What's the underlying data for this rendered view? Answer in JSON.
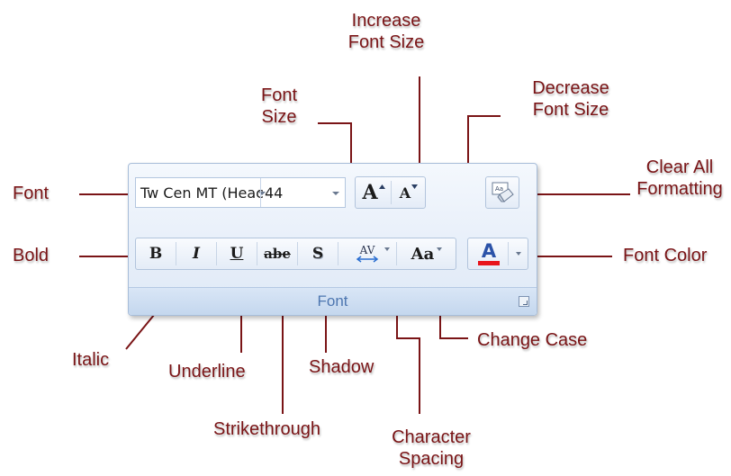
{
  "labels": {
    "increase_font_size": [
      "Increase",
      "Font Size"
    ],
    "font_size": [
      "Font",
      "Size"
    ],
    "decrease_font_size": [
      "Decrease",
      "Font Size"
    ],
    "clear_all_formatting": [
      "Clear All",
      "Formatting"
    ],
    "font": "Font",
    "bold": "Bold",
    "font_color": "Font Color",
    "italic": "Italic",
    "underline": "Underline",
    "strikethrough": "Strikethrough",
    "shadow": "Shadow",
    "change_case": "Change Case",
    "character_spacing": [
      "Character",
      "Spacing"
    ]
  },
  "ribbon": {
    "group_title": "Font",
    "font_name": "Tw Cen MT (Heac",
    "font_size": "44",
    "buttons": {
      "grow": "A",
      "shrink": "A",
      "bold": "B",
      "italic": "I",
      "underline": "U",
      "strikethrough": "abe",
      "shadow": "S",
      "char_spacing": "AV",
      "change_case": "Aa",
      "font_color": "A"
    }
  },
  "colors": {
    "label": "#7a1416",
    "font_color_bar": "#e8141c",
    "group_title": "#4d76b0"
  }
}
